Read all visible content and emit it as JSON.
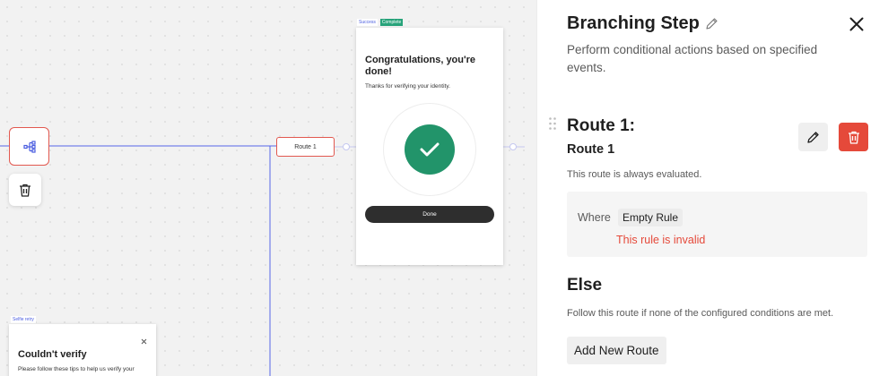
{
  "canvas": {
    "route_node_label": "Route 1",
    "success_screen": {
      "tag_success": "Success",
      "tag_complete": "Complete",
      "title": "Congratulations, you're done!",
      "subtitle": "Thanks for verifying your identity.",
      "button_label": "Done"
    },
    "retry_screen": {
      "tag": "Selfie retry",
      "title": "Couldn't verify",
      "subtitle": "Please follow these tips to help us verify your"
    }
  },
  "panel": {
    "title": "Branching Step",
    "description": "Perform conditional actions based on specified events.",
    "route": {
      "heading": "Route 1:",
      "name": "Route 1",
      "note": "This route is always evaluated.",
      "where_label": "Where",
      "rule_chip": "Empty Rule",
      "rule_error": "This rule is invalid"
    },
    "else": {
      "heading": "Else",
      "description": "Follow this route if none of the configured conditions are met."
    },
    "add_route_label": "Add New Route"
  },
  "colors": {
    "accent_red": "#e5493a",
    "connector_blue": "#5566e8",
    "success_green": "#22946a"
  }
}
